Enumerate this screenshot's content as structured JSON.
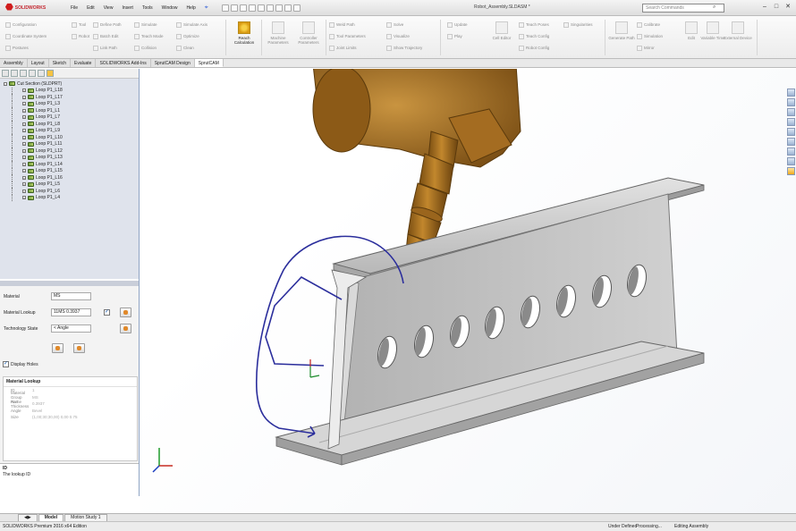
{
  "app": {
    "logo_text": "SOLIDWORKS",
    "doc_title": "Robot_Assembly.SLDASM *",
    "search_placeholder": "Search Commands",
    "menu": [
      "File",
      "Edit",
      "View",
      "Insert",
      "Tools",
      "Window",
      "Help"
    ]
  },
  "ribbon": {
    "groups": [
      [
        "Configuration",
        "Coordinate System",
        "Postures"
      ],
      [
        "Tool",
        "Robot"
      ],
      [
        "Define Path",
        "Batch Edit",
        "Link Path"
      ],
      [
        "Simulate",
        "Teach Mode",
        "Collision"
      ],
      [
        "Simulate Axis",
        "Optimize",
        "Clean"
      ],
      [
        "Weld Path",
        "Tool Parameters",
        "Joint Limits"
      ],
      [
        "Solve",
        "Visualize",
        "Show Trajectory"
      ],
      [
        "Teach Poses",
        "Teach Config",
        "Robot Config"
      ],
      [
        "Update",
        "Play"
      ],
      [
        "Transfer Trajectory",
        "Export",
        "Import Settings"
      ],
      [
        "Singularities"
      ],
      [
        "Calibrate",
        "Simulation",
        "Mirror"
      ]
    ],
    "big_buttons": [
      "Reach Calculation",
      "Machine Parameters",
      "Controller Parameters",
      "Cell Editor",
      "Generate Path",
      "Edit",
      "Options",
      "Tool Attach",
      "Variable Time",
      "External Device"
    ],
    "active_button": "Reach Calculation"
  },
  "tabs": [
    "Assembly",
    "Layout",
    "Sketch",
    "Evaluate",
    "SOLIDWORKS Add-Ins",
    "SprutCAM Design",
    "SprutCAM"
  ],
  "active_tab": "SprutCAM",
  "tree": {
    "root": "Cut Section (SLDPRT)",
    "items": [
      "Loop P1_L18",
      "Loop P1_L17",
      "Loop P1_L3",
      "Loop P1_L1",
      "Loop P1_L7",
      "Loop P1_L8",
      "Loop P1_L9",
      "Loop P1_L10",
      "Loop P1_L11",
      "Loop P1_L12",
      "Loop P1_L13",
      "Loop P1_L14",
      "Loop P1_L15",
      "Loop P1_L16",
      "Loop P1_L5",
      "Loop P1_L6",
      "Loop P1_L4"
    ]
  },
  "props": {
    "material_label": "Material",
    "material_value": "MS",
    "lookup_label": "Material Lookup",
    "lookup_value": "11MS  0.3937",
    "tech_label": "Technology State",
    "tech_value": "< Angle",
    "display_holes_label": "Display Holes",
    "display_holes_checked": true,
    "lookup_checked": true
  },
  "inspector": {
    "title": "Material Lookup",
    "rows": [
      {
        "k": "ID",
        "v": "1"
      },
      {
        "k": "Material Group Name",
        "v": "MS"
      },
      {
        "k": "Part Thickness",
        "v": "0.3937"
      },
      {
        "k": "Angle",
        "v": "Bevel"
      },
      {
        "k": "Size",
        "v": "(1,00;30;30,00) 0,00 0.75"
      }
    ]
  },
  "description": {
    "title": "ID",
    "text": "The lookup ID"
  },
  "bottom_tabs": [
    "Model",
    "Motion Study 1"
  ],
  "active_bottom_tab": "Model",
  "status": {
    "left": "SOLIDWORKS Premium 2016 x64 Edition",
    "s1": "Under Defined",
    "s2": "Processing...",
    "s3": "Editing Assembly"
  },
  "colors": {
    "robot": "#a06a1d",
    "beam": "#bdbdbd",
    "path": "#2b2e9c",
    "panel_tree": "#dfe3ec"
  }
}
